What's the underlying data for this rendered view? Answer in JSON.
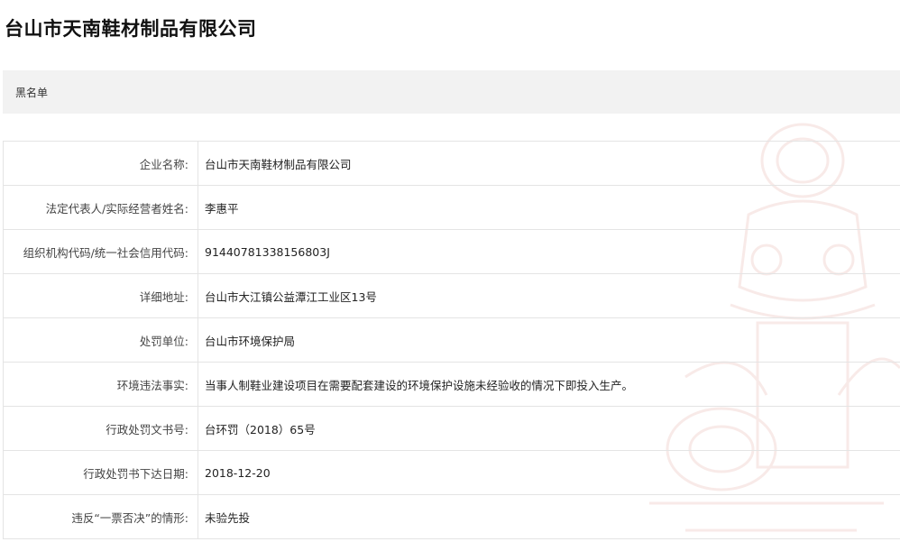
{
  "page": {
    "title": "台山市天南鞋材制品有限公司",
    "tag": "黑名单"
  },
  "rows": [
    {
      "label": "企业名称:",
      "value": "台山市天南鞋材制品有限公司"
    },
    {
      "label": "法定代表人/实际经营者姓名:",
      "value": "李惠平"
    },
    {
      "label": "组织机构代码/统一社会信用代码:",
      "value": "91440781338156803J"
    },
    {
      "label": "详细地址:",
      "value": "台山市大江镇公益潭江工业区13号"
    },
    {
      "label": "处罚单位:",
      "value": "台山市环境保护局"
    },
    {
      "label": "环境违法事实:",
      "value": "当事人制鞋业建设项目在需要配套建设的环境保护设施未经验收的情况下即投入生产。"
    },
    {
      "label": "行政处罚文书号:",
      "value": "台环罚（2018）65号"
    },
    {
      "label": "行政处罚书下达日期:",
      "value": "2018-12-20"
    },
    {
      "label": "违反“一票否决”的情形:",
      "value": "未验先投"
    }
  ],
  "colors": {
    "tag_bar_bg": "#f2f2f2",
    "border": "#e4e4e4",
    "watermark": "#c0392b"
  }
}
